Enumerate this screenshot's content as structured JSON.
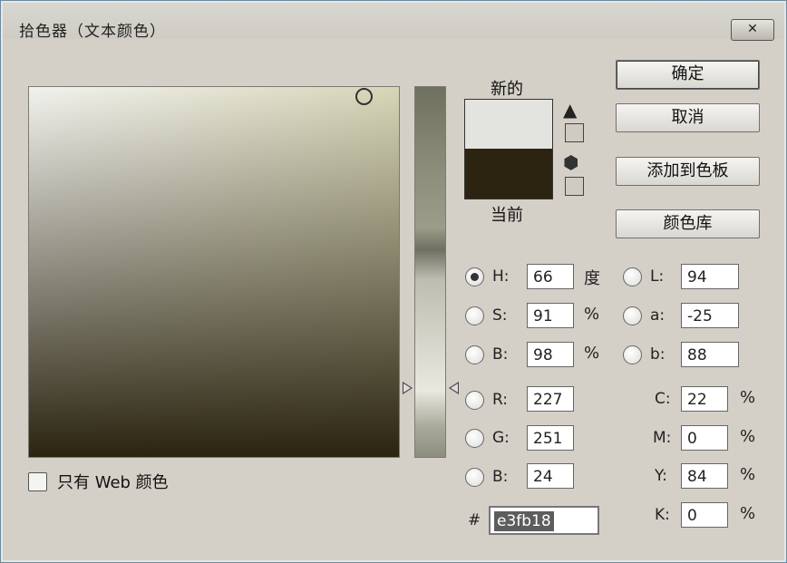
{
  "window": {
    "title": "拾色器（文本颜色）",
    "close_label": "✕"
  },
  "preview": {
    "new_label": "新的",
    "current_label": "当前",
    "new_color": "#e3e3e0",
    "current_color": "#2c2410"
  },
  "icons": {
    "gamut_warning": "warning-icon",
    "web_safe": "cube-icon"
  },
  "buttons": {
    "ok": "确定",
    "cancel": "取消",
    "add_swatch": "添加到色板",
    "libraries": "颜色库"
  },
  "web_only": {
    "label": "只有 Web 颜色",
    "checked": false
  },
  "hsb": {
    "h": {
      "label": "H:",
      "value": "66",
      "unit": "度",
      "selected": true
    },
    "s": {
      "label": "S:",
      "value": "91",
      "unit": "%"
    },
    "b": {
      "label": "B:",
      "value": "98",
      "unit": "%"
    }
  },
  "rgb": {
    "r": {
      "label": "R:",
      "value": "227"
    },
    "g": {
      "label": "G:",
      "value": "251"
    },
    "b": {
      "label": "B:",
      "value": "24"
    }
  },
  "lab": {
    "l": {
      "label": "L:",
      "value": "94"
    },
    "a": {
      "label": "a:",
      "value": "-25"
    },
    "b": {
      "label": "b:",
      "value": "88"
    }
  },
  "cmyk": {
    "c": {
      "label": "C:",
      "value": "22",
      "unit": "%"
    },
    "m": {
      "label": "M:",
      "value": "0",
      "unit": "%"
    },
    "y": {
      "label": "Y:",
      "value": "84",
      "unit": "%"
    },
    "k": {
      "label": "K:",
      "value": "0",
      "unit": "%"
    }
  },
  "hex": {
    "label": "#",
    "value": "e3fb18"
  }
}
